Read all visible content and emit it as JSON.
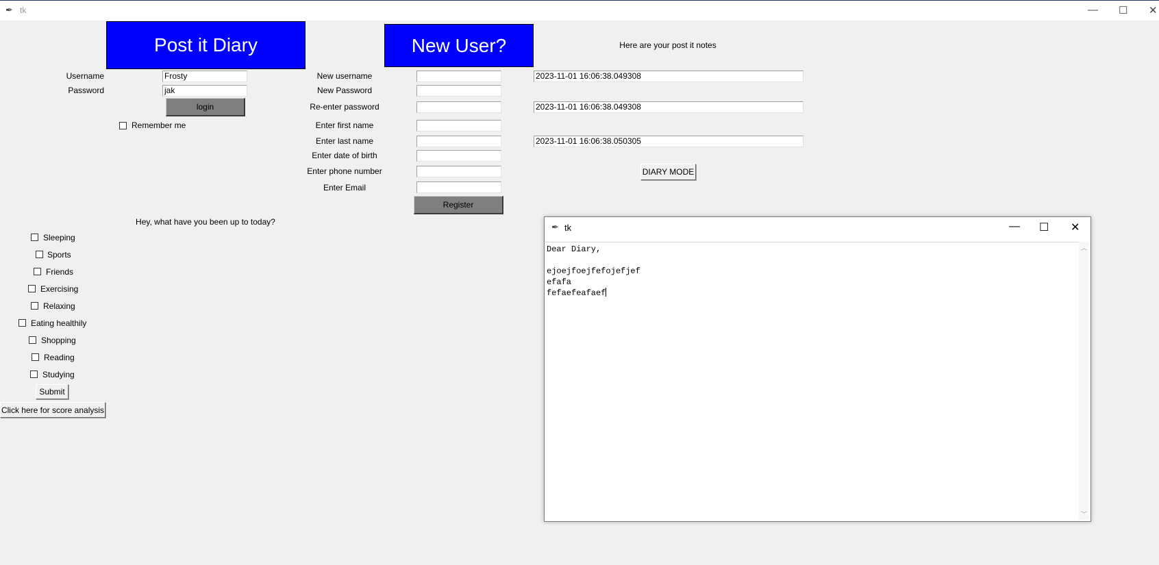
{
  "main_window": {
    "title": "tk",
    "controls": {
      "minimize": "—",
      "maximize": "☐",
      "close": "✕"
    }
  },
  "login": {
    "header_button": "Post it Diary",
    "username_label": "Username",
    "username_value": "Frosty",
    "password_label": "Password",
    "password_value": "jak",
    "login_button": "login",
    "remember_label": "Remember me"
  },
  "register": {
    "header_button": "New User?",
    "fields": [
      {
        "label": "New username",
        "value": ""
      },
      {
        "label": "New Password",
        "value": ""
      },
      {
        "label": "Re-enter password",
        "value": ""
      },
      {
        "label": "Enter first name",
        "value": ""
      },
      {
        "label": "Enter last name",
        "value": ""
      },
      {
        "label": "Enter date of birth",
        "value": ""
      },
      {
        "label": "Enter phone number",
        "value": ""
      },
      {
        "label": "Enter Email",
        "value": ""
      }
    ],
    "register_button": "Register"
  },
  "notes": {
    "heading": "Here are your post it notes",
    "entries": [
      "2023-11-01 16:06:38.049308",
      "2023-11-01 16:06:38.049308",
      "2023-11-01 16:06:38.050305"
    ],
    "diary_mode_button": "DIARY MODE"
  },
  "activities": {
    "question": "Hey, what have you been up to today?",
    "items": [
      "Sleeping",
      "Sports",
      "Friends",
      "Exercising",
      "Relaxing",
      "Eating healthily",
      "Shopping",
      "Reading",
      "Studying"
    ],
    "submit_button": "Submit",
    "score_button": "Click here for score analysis"
  },
  "diary_window": {
    "title": "tk",
    "controls": {
      "minimize": "—",
      "maximize": "☐",
      "close": "✕"
    },
    "text": "Dear Diary,\n\nejoejfoejfefojefjef\nefafa\nfefaefeafaef"
  }
}
